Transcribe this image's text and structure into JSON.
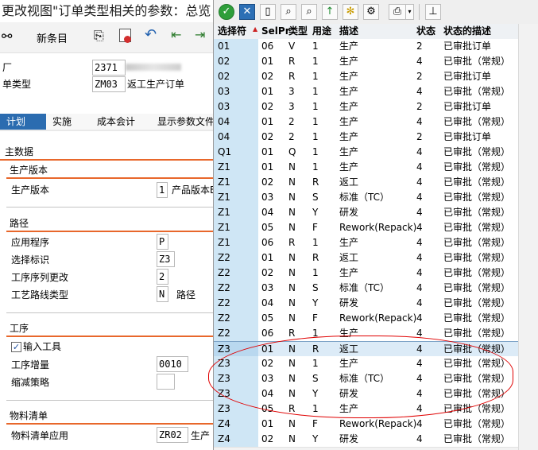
{
  "window_title": "更改视图\"订单类型相关的参数：总览",
  "toolbar": {
    "new_entries_label": "新条目"
  },
  "fields": {
    "plant_label": "厂",
    "plant_value": "2371",
    "order_type_label": "单类型",
    "order_type_value": "ZM03",
    "order_type_desc": "返工生产订单"
  },
  "tabs": [
    "计划",
    "实施",
    "成本会计",
    "显示参数文件"
  ],
  "sections": {
    "master_data": "主数据",
    "production_version_group": "生产版本",
    "production_version_label": "生产版本",
    "production_version_value": "1",
    "production_version_text": "产品版本B",
    "routing_group": "路径",
    "application_label": "应用程序",
    "application_value": "P",
    "selection_id_label": "选择标识",
    "selection_id_value": "Z3",
    "seq_change_label": "工序序列更改",
    "seq_change_value": "2",
    "routing_type_label": "工艺路线类型",
    "routing_type_value": "N",
    "routing_type_text": "路径",
    "operations_group": "工序",
    "input_tool_label": "输入工具",
    "op_increment_label": "工序增量",
    "op_increment_value": "0010",
    "reduction_label": "缩减策略",
    "bom_group": "物料清单",
    "bom_app_label": "物料清单应用",
    "bom_app_value": "ZR02",
    "bom_app_text": "生产"
  },
  "popup": {
    "columns": [
      "选择符",
      "SelPr",
      "类型",
      "用途",
      "描述",
      "状态",
      "状态的描述"
    ],
    "rows": [
      [
        "01",
        "06",
        "V",
        "1",
        "生产",
        "2",
        "已审批订单"
      ],
      [
        "02",
        "01",
        "R",
        "1",
        "生产",
        "4",
        "已审批（常规）"
      ],
      [
        "02",
        "02",
        "R",
        "1",
        "生产",
        "2",
        "已审批订单"
      ],
      [
        "03",
        "01",
        "3",
        "1",
        "生产",
        "4",
        "已审批（常规）"
      ],
      [
        "03",
        "02",
        "3",
        "1",
        "生产",
        "2",
        "已审批订单"
      ],
      [
        "04",
        "01",
        "2",
        "1",
        "生产",
        "4",
        "已审批（常规）"
      ],
      [
        "04",
        "02",
        "2",
        "1",
        "生产",
        "2",
        "已审批订单"
      ],
      [
        "Q1",
        "01",
        "Q",
        "1",
        "生产",
        "4",
        "已审批（常规）"
      ],
      [
        "Z1",
        "01",
        "N",
        "1",
        "生产",
        "4",
        "已审批（常规）"
      ],
      [
        "Z1",
        "02",
        "N",
        "R",
        "返工",
        "4",
        "已审批（常规）"
      ],
      [
        "Z1",
        "03",
        "N",
        "S",
        "标准（TC）",
        "4",
        "已审批（常规）"
      ],
      [
        "Z1",
        "04",
        "N",
        "Y",
        "研发",
        "4",
        "已审批（常规）"
      ],
      [
        "Z1",
        "05",
        "N",
        "F",
        "Rework(Repack)",
        "4",
        "已审批（常规）"
      ],
      [
        "Z1",
        "06",
        "R",
        "1",
        "生产",
        "4",
        "已审批（常规）"
      ],
      [
        "Z2",
        "01",
        "N",
        "R",
        "返工",
        "4",
        "已审批（常规）"
      ],
      [
        "Z2",
        "02",
        "N",
        "1",
        "生产",
        "4",
        "已审批（常规）"
      ],
      [
        "Z2",
        "03",
        "N",
        "S",
        "标准（TC）",
        "4",
        "已审批（常规）"
      ],
      [
        "Z2",
        "04",
        "N",
        "Y",
        "研发",
        "4",
        "已审批（常规）"
      ],
      [
        "Z2",
        "05",
        "N",
        "F",
        "Rework(Repack)",
        "4",
        "已审批（常规）"
      ],
      [
        "Z2",
        "06",
        "R",
        "1",
        "生产",
        "4",
        "已审批（常规）"
      ],
      [
        "Z3",
        "01",
        "N",
        "R",
        "返工",
        "4",
        "已审批（常规）"
      ],
      [
        "Z3",
        "02",
        "N",
        "1",
        "生产",
        "4",
        "已审批（常规）"
      ],
      [
        "Z3",
        "03",
        "N",
        "S",
        "标准（TC）",
        "4",
        "已审批（常规）"
      ],
      [
        "Z3",
        "04",
        "N",
        "Y",
        "研发",
        "4",
        "已审批（常规）"
      ],
      [
        "Z3",
        "05",
        "R",
        "1",
        "生产",
        "4",
        "已审批（常规）"
      ],
      [
        "Z4",
        "01",
        "N",
        "F",
        "Rework(Repack)",
        "4",
        "已审批（常规）"
      ],
      [
        "Z4",
        "02",
        "N",
        "Y",
        "研发",
        "4",
        "已审批（常规）"
      ]
    ],
    "selected_row_index": 20
  },
  "colors": {
    "accent_orange": "#e8672b",
    "tab_blue": "#2b6cb0",
    "selector_blue": "#cfe6f5",
    "annotation_red": "#e00000"
  }
}
